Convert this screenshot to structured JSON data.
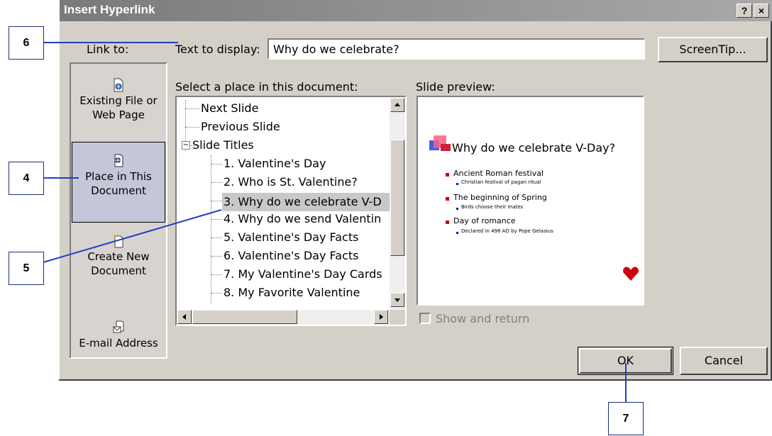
{
  "dialog": {
    "title": "Insert Hyperlink",
    "help_label": "?",
    "close_label": "×",
    "link_to_label": "Link to:",
    "text_to_display_label": "Text to display:",
    "text_to_display_value": "Why do we celebrate?",
    "screentip_label": "ScreenTip...",
    "select_place_label": "Select a place in this document:",
    "slide_preview_label": "Slide preview:",
    "show_and_return_label": "Show and return",
    "ok_label": "OK",
    "cancel_label": "Cancel"
  },
  "link_to": [
    {
      "label_line1": "Existing File or",
      "label_line2": "Web Page",
      "icon": "web-file-icon"
    },
    {
      "label_line1": "Place in This",
      "label_line2": "Document",
      "icon": "document-place-icon",
      "selected": true
    },
    {
      "label_line1": "Create New",
      "label_line2": "Document",
      "icon": "new-document-icon"
    },
    {
      "label_line1": "E-mail Address",
      "label_line2": "",
      "icon": "email-icon"
    }
  ],
  "tree": {
    "items": [
      {
        "text": "Next Slide"
      },
      {
        "text": "Previous Slide"
      },
      {
        "text": "Slide Titles",
        "expander": "−"
      },
      {
        "text": "1. Valentine's Day"
      },
      {
        "text": "2. Who is St. Valentine?"
      },
      {
        "text": "3. Why do we celebrate V-D",
        "selected": true
      },
      {
        "text": "4. Why do we send Valentin"
      },
      {
        "text": "5. Valentine's Day Facts"
      },
      {
        "text": "6. Valentine's Day Facts"
      },
      {
        "text": "7. My Valentine's Day Cards"
      },
      {
        "text": "8. My Favorite Valentine"
      }
    ]
  },
  "slide": {
    "title": "Why do we celebrate V-Day?",
    "bullets": [
      {
        "text": "Ancient Roman festival",
        "sub": "Christian festival of pagan ritual"
      },
      {
        "text": "The beginning of Spring",
        "sub": "Birds choose their mates"
      },
      {
        "text": "Day of romance",
        "sub": "Declared in 498 AD by Pope Gelasius"
      }
    ]
  },
  "callouts": {
    "c4": "4",
    "c5": "5",
    "c6": "6",
    "c7": "7"
  },
  "colors": {
    "callout_line": "#2040c0",
    "bullet_red": "#cc0000",
    "bullet_blue": "#0000cc"
  }
}
